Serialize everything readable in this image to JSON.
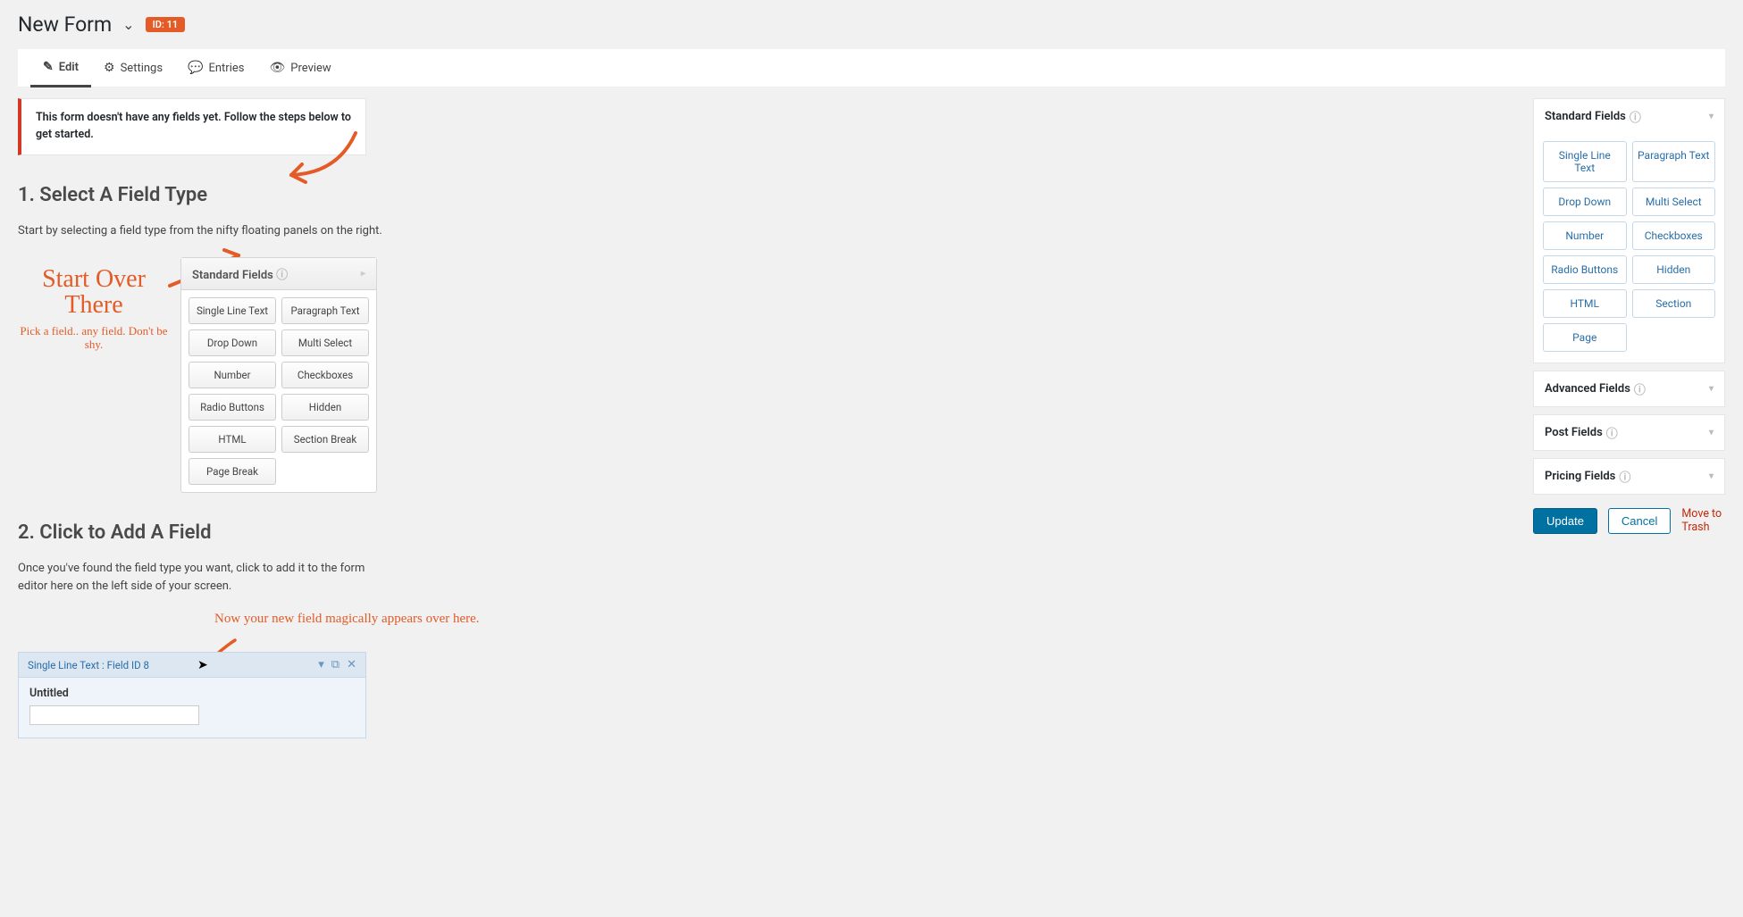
{
  "header": {
    "title": "New Form",
    "id_label": "ID: 11"
  },
  "tabs": {
    "edit": "Edit",
    "settings": "Settings",
    "entries": "Entries",
    "preview": "Preview"
  },
  "notice": "This form doesn't have any fields yet. Follow the steps below to get started.",
  "section1": {
    "heading": "1. Select A Field Type",
    "text": "Start by selecting a field type from the nifty floating panels on the right."
  },
  "annot1": {
    "big": "Start Over There",
    "small": "Pick a field.. any field. Don't be shy."
  },
  "mini_panel": {
    "title": "Standard Fields",
    "buttons": [
      "Single Line Text",
      "Paragraph Text",
      "Drop Down",
      "Multi Select",
      "Number",
      "Checkboxes",
      "Radio Buttons",
      "Hidden",
      "HTML",
      "Section Break",
      "Page Break"
    ]
  },
  "section2": {
    "heading": "2. Click to Add A Field",
    "text": "Once you've found the field type you want, click to add it to the form editor here on the left side of your screen."
  },
  "annot2": "Now your new field magically appears over here.",
  "field_preview": {
    "header": "Single Line Text : Field ID 8",
    "label": "Untitled"
  },
  "sidebar": {
    "standard": {
      "title": "Standard Fields",
      "buttons": [
        "Single Line Text",
        "Paragraph Text",
        "Drop Down",
        "Multi Select",
        "Number",
        "Checkboxes",
        "Radio Buttons",
        "Hidden",
        "HTML",
        "Section",
        "Page"
      ]
    },
    "advanced": "Advanced Fields",
    "post": "Post Fields",
    "pricing": "Pricing Fields"
  },
  "actions": {
    "update": "Update",
    "cancel": "Cancel",
    "trash": "Move to Trash"
  }
}
